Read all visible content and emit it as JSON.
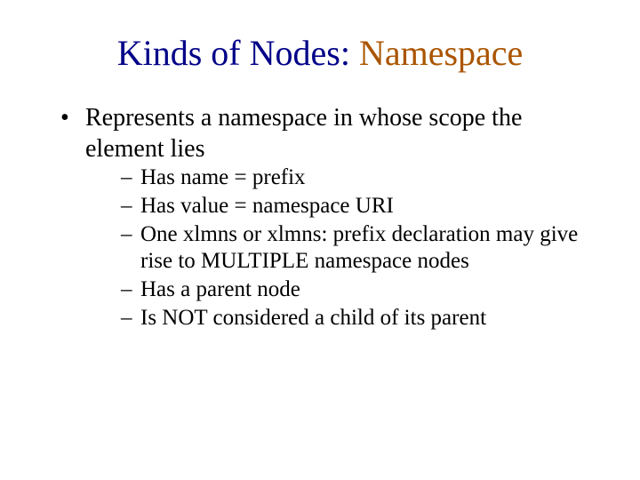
{
  "title": {
    "main": "Kinds of Nodes: ",
    "accent": "Namespace"
  },
  "bullets": [
    {
      "text": "Represents a namespace in whose  scope the element lies",
      "sub": [
        "Has name = prefix",
        "Has value  = namespace URI",
        "One xlmns or xlmns: prefix declaration may give rise to  MULTIPLE namespace nodes",
        "Has a parent node",
        "Is NOT  considered a child of its parent"
      ]
    }
  ]
}
